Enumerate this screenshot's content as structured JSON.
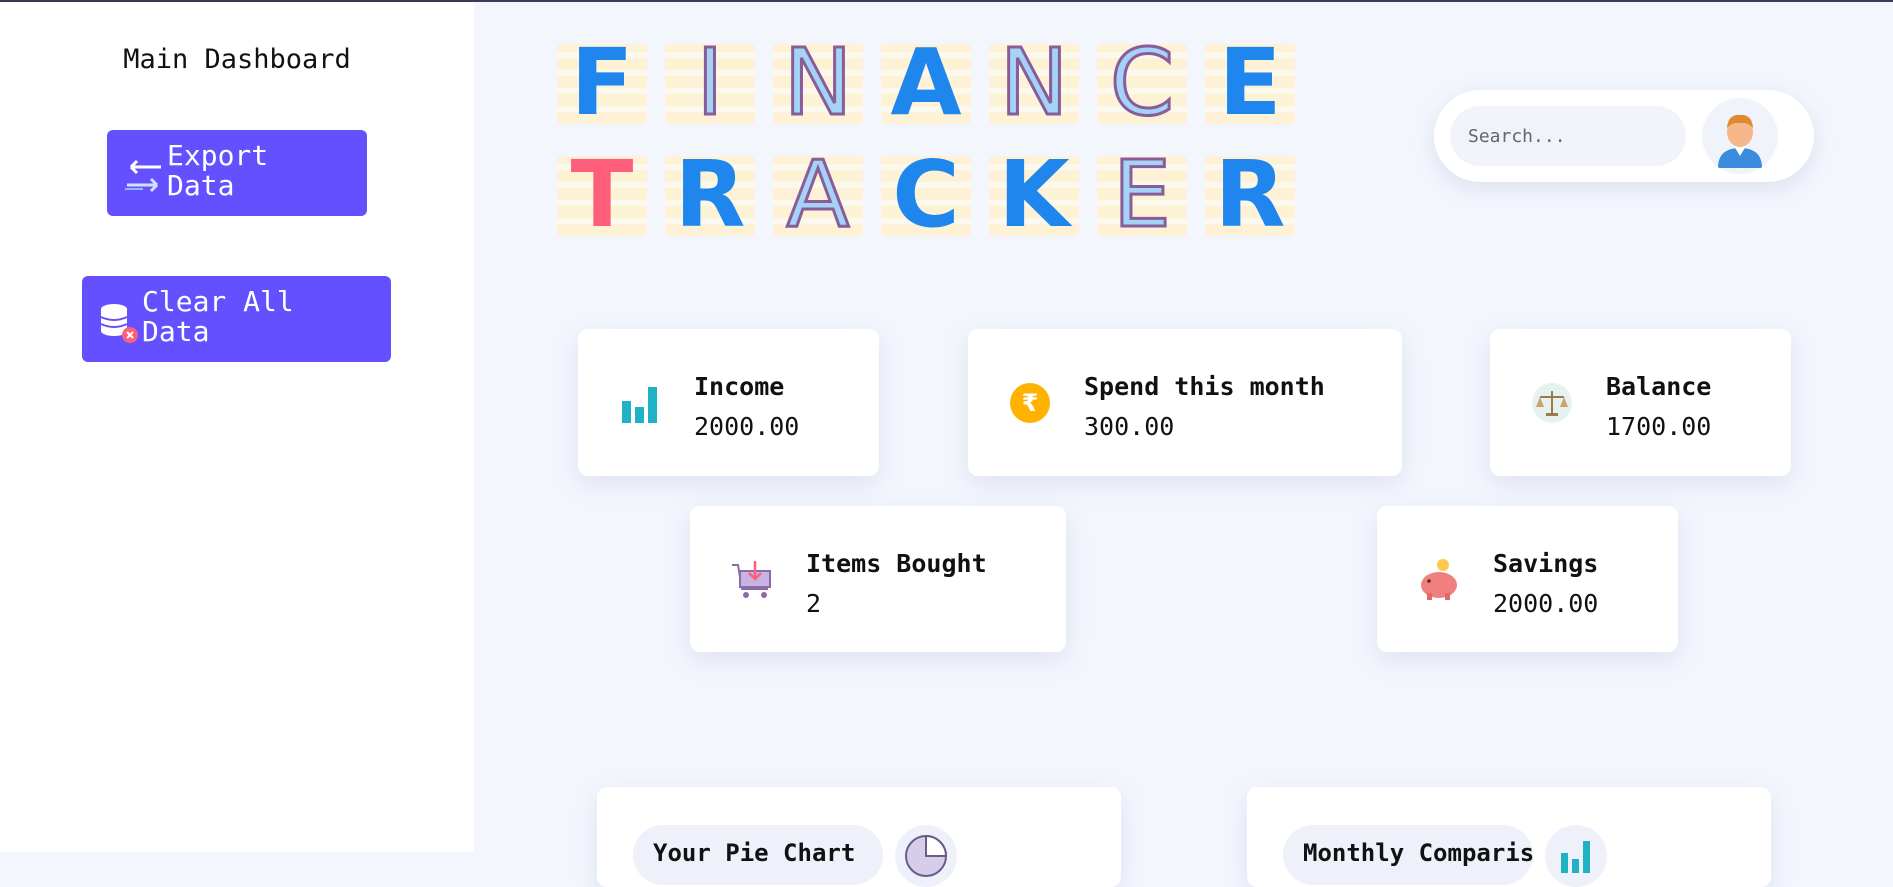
{
  "sidebar": {
    "title": "Main Dashboard",
    "export_label": "Export Data",
    "clear_label": "Clear All Data"
  },
  "banner": {
    "row1": [
      "F",
      "I",
      "N",
      "A",
      "N",
      "C",
      "E"
    ],
    "row2": [
      "T",
      "R",
      "A",
      "C",
      "K",
      "E",
      "R"
    ]
  },
  "search": {
    "placeholder": "Search..."
  },
  "cards": {
    "income": {
      "label": "Income",
      "value": "2000.00",
      "icon": "bar-chart-icon"
    },
    "spend": {
      "label": "Spend this month",
      "value": "300.00",
      "icon": "rupee-coin-icon"
    },
    "balance": {
      "label": "Balance",
      "value": "1700.00",
      "icon": "scales-icon"
    },
    "items": {
      "label": "Items Bought",
      "value": "2",
      "icon": "shopping-basket-icon"
    },
    "savings": {
      "label": "Savings",
      "value": "2000.00",
      "icon": "piggy-bank-icon"
    }
  },
  "bottom": {
    "left_pill": "Your Pie Chart",
    "right_pill": "Monthly Comparison"
  },
  "colors": {
    "accent": "#6550ff",
    "background": "#f3f6fd",
    "tile_blue": "#1f86ee",
    "tile_pink": "#ff5e7a"
  }
}
